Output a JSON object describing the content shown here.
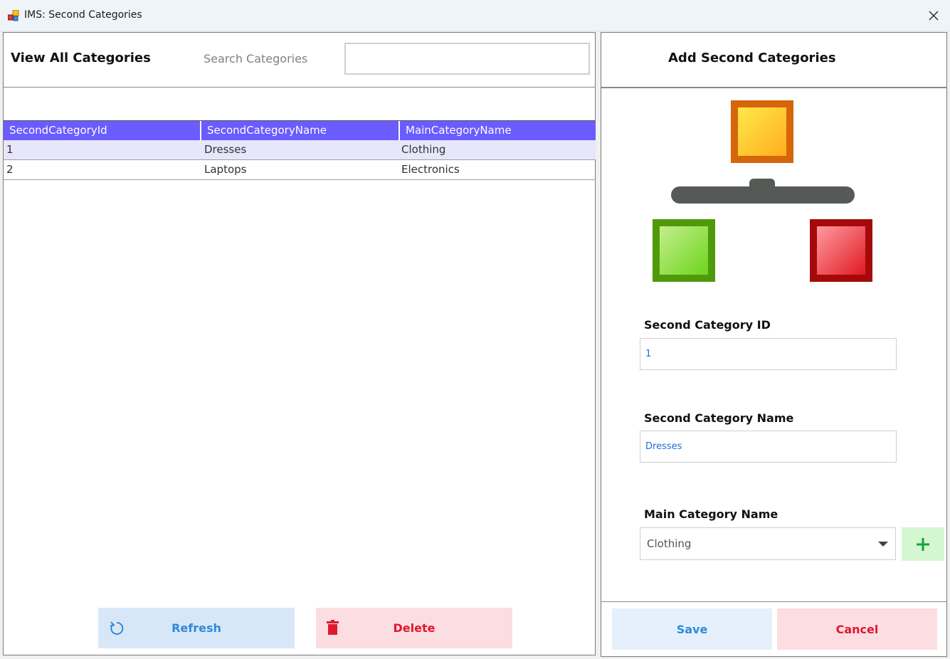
{
  "window": {
    "title": "IMS: Second Categories",
    "icon": "app-icon"
  },
  "left": {
    "heading": "View All Categories",
    "search_label": "Search Categories",
    "search_value": "",
    "grid": {
      "columns": [
        "SecondCategoryId",
        "SecondCategoryName",
        "MainCategoryName"
      ],
      "rows": [
        [
          "1",
          "Dresses",
          "Clothing"
        ],
        [
          "2",
          "Laptops",
          "Electronics"
        ]
      ],
      "selected_row": 0
    },
    "refresh_label": "Refresh",
    "delete_label": "Delete"
  },
  "right": {
    "heading": "Add Second Categories",
    "id_label": "Second Category ID",
    "id_value": "1",
    "name_label": "Second Category Name",
    "name_value": "Dresses",
    "main_label": "Main Category Name",
    "main_value": "Clothing",
    "save_label": "Save",
    "cancel_label": "Cancel"
  },
  "colors": {
    "grid_header": "#6a5cff",
    "selected_row": "#e7e6fa",
    "refresh_bg": "#d8e7f8",
    "delete_bg": "#fbdde2",
    "add_bg": "#d3f7d0"
  }
}
